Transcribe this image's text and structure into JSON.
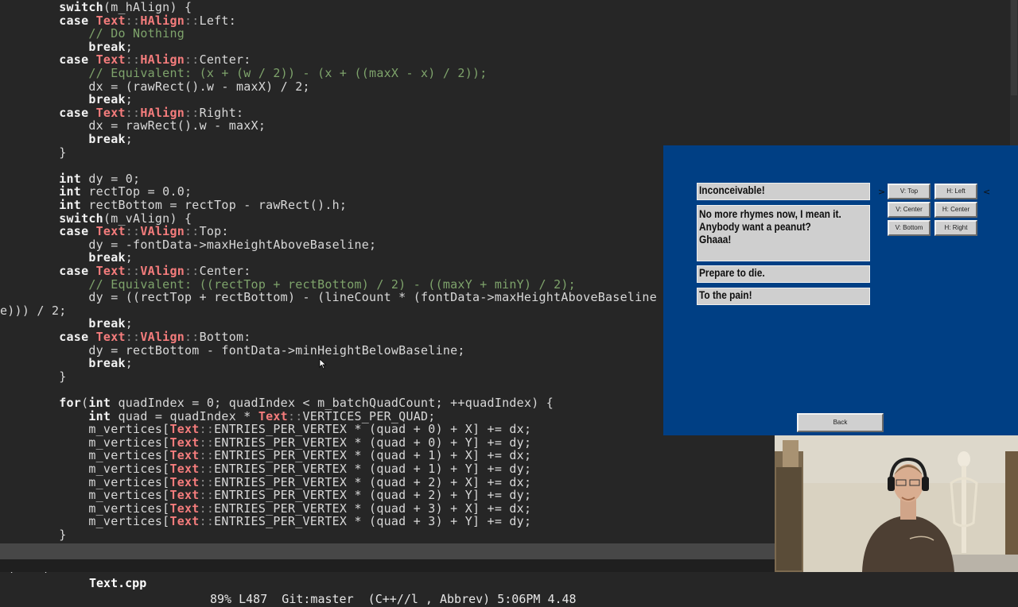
{
  "editor": {
    "lines": [
      [
        {
          "t": "        "
        },
        {
          "t": "switch",
          "c": "kw"
        },
        {
          "t": "(m_hAlign) {"
        }
      ],
      [
        {
          "t": "        "
        },
        {
          "t": "case",
          "c": "kw"
        },
        {
          "t": " "
        },
        {
          "t": "Text",
          "c": "type"
        },
        {
          "t": "::",
          "c": "punct"
        },
        {
          "t": "HAlign",
          "c": "type"
        },
        {
          "t": "::",
          "c": "punct"
        },
        {
          "t": "Left:"
        }
      ],
      [
        {
          "t": "            "
        },
        {
          "t": "// Do Nothing",
          "c": "comment"
        }
      ],
      [
        {
          "t": "            "
        },
        {
          "t": "break",
          "c": "kw"
        },
        {
          "t": ";"
        }
      ],
      [
        {
          "t": "        "
        },
        {
          "t": "case",
          "c": "kw"
        },
        {
          "t": " "
        },
        {
          "t": "Text",
          "c": "type"
        },
        {
          "t": "::",
          "c": "punct"
        },
        {
          "t": "HAlign",
          "c": "type"
        },
        {
          "t": "::",
          "c": "punct"
        },
        {
          "t": "Center:"
        }
      ],
      [
        {
          "t": "            "
        },
        {
          "t": "// Equivalent: (x + (w / 2)) - (x + ((maxX - x) / 2));",
          "c": "comment"
        }
      ],
      [
        {
          "t": "            dx = (rawRect().w - maxX) / 2;"
        }
      ],
      [
        {
          "t": "            "
        },
        {
          "t": "break",
          "c": "kw"
        },
        {
          "t": ";"
        }
      ],
      [
        {
          "t": "        "
        },
        {
          "t": "case",
          "c": "kw"
        },
        {
          "t": " "
        },
        {
          "t": "Text",
          "c": "type"
        },
        {
          "t": "::",
          "c": "punct"
        },
        {
          "t": "HAlign",
          "c": "type"
        },
        {
          "t": "::",
          "c": "punct"
        },
        {
          "t": "Right:"
        }
      ],
      [
        {
          "t": "            dx = rawRect().w - maxX;"
        }
      ],
      [
        {
          "t": "            "
        },
        {
          "t": "break",
          "c": "kw"
        },
        {
          "t": ";"
        }
      ],
      [
        {
          "t": "        }"
        }
      ],
      [
        {
          "t": ""
        }
      ],
      [
        {
          "t": "        "
        },
        {
          "t": "int",
          "c": "kw"
        },
        {
          "t": " dy = 0;"
        }
      ],
      [
        {
          "t": "        "
        },
        {
          "t": "int",
          "c": "kw"
        },
        {
          "t": " rectTop = 0.0;"
        }
      ],
      [
        {
          "t": "        "
        },
        {
          "t": "int",
          "c": "kw"
        },
        {
          "t": " rectBottom = rectTop - rawRect().h;"
        }
      ],
      [
        {
          "t": "        "
        },
        {
          "t": "switch",
          "c": "kw"
        },
        {
          "t": "(m_vAlign) {"
        }
      ],
      [
        {
          "t": "        "
        },
        {
          "t": "case",
          "c": "kw"
        },
        {
          "t": " "
        },
        {
          "t": "Text",
          "c": "type"
        },
        {
          "t": "::",
          "c": "punct"
        },
        {
          "t": "VAlign",
          "c": "type"
        },
        {
          "t": "::",
          "c": "punct"
        },
        {
          "t": "Top:"
        }
      ],
      [
        {
          "t": "            dy = -fontData->maxHeightAboveBaseline;"
        }
      ],
      [
        {
          "t": "            "
        },
        {
          "t": "break",
          "c": "kw"
        },
        {
          "t": ";"
        }
      ],
      [
        {
          "t": "        "
        },
        {
          "t": "case",
          "c": "kw"
        },
        {
          "t": " "
        },
        {
          "t": "Text",
          "c": "type"
        },
        {
          "t": "::",
          "c": "punct"
        },
        {
          "t": "VAlign",
          "c": "type"
        },
        {
          "t": "::",
          "c": "punct"
        },
        {
          "t": "Center:"
        }
      ],
      [
        {
          "t": "            "
        },
        {
          "t": "// Equivalent: ((rectTop + rectBottom) / 2) - ((maxY + minY) / 2);",
          "c": "comment"
        }
      ],
      [
        {
          "t": "            dy = ((rectTop + rectBottom) - (lineCount * (fontData->maxHeightAboveBaseline"
        }
      ],
      [
        {
          "t": "e))) / 2;"
        }
      ],
      [
        {
          "t": "            "
        },
        {
          "t": "break",
          "c": "kw"
        },
        {
          "t": ";"
        }
      ],
      [
        {
          "t": "        "
        },
        {
          "t": "case",
          "c": "kw"
        },
        {
          "t": " "
        },
        {
          "t": "Text",
          "c": "type"
        },
        {
          "t": "::",
          "c": "punct"
        },
        {
          "t": "VAlign",
          "c": "type"
        },
        {
          "t": "::",
          "c": "punct"
        },
        {
          "t": "Bottom:"
        }
      ],
      [
        {
          "t": "            dy = rectBottom - fontData->minHeightBelowBaseline;"
        }
      ],
      [
        {
          "t": "            "
        },
        {
          "t": "break",
          "c": "kw"
        },
        {
          "t": ";"
        }
      ],
      [
        {
          "t": "        }"
        }
      ],
      [
        {
          "t": ""
        }
      ],
      [
        {
          "t": "        "
        },
        {
          "t": "for",
          "c": "kw"
        },
        {
          "t": "("
        },
        {
          "t": "int",
          "c": "kw"
        },
        {
          "t": " quadIndex = 0; quadIndex < m_batchQuadCount; ++quadIndex) {"
        }
      ],
      [
        {
          "t": "            "
        },
        {
          "t": "int",
          "c": "kw"
        },
        {
          "t": " quad = quadIndex * "
        },
        {
          "t": "Text",
          "c": "type"
        },
        {
          "t": "::",
          "c": "punct"
        },
        {
          "t": "VERTICES_PER_QUAD;"
        }
      ],
      [
        {
          "t": "            m_vertices["
        },
        {
          "t": "Text",
          "c": "type"
        },
        {
          "t": "::",
          "c": "punct"
        },
        {
          "t": "ENTRIES_PER_VERTEX * (quad + 0) + X] += dx;"
        }
      ],
      [
        {
          "t": "            m_vertices["
        },
        {
          "t": "Text",
          "c": "type"
        },
        {
          "t": "::",
          "c": "punct"
        },
        {
          "t": "ENTRIES_PER_VERTEX * (quad + 0) + Y] += dy;"
        }
      ],
      [
        {
          "t": "            m_vertices["
        },
        {
          "t": "Text",
          "c": "type"
        },
        {
          "t": "::",
          "c": "punct"
        },
        {
          "t": "ENTRIES_PER_VERTEX * (quad + 1) + X] += dx;"
        }
      ],
      [
        {
          "t": "            m_vertices["
        },
        {
          "t": "Text",
          "c": "type"
        },
        {
          "t": "::",
          "c": "punct"
        },
        {
          "t": "ENTRIES_PER_VERTEX * (quad + 1) + Y] += dy;"
        }
      ],
      [
        {
          "t": "            m_vertices["
        },
        {
          "t": "Text",
          "c": "type"
        },
        {
          "t": "::",
          "c": "punct"
        },
        {
          "t": "ENTRIES_PER_VERTEX * (quad + 2) + X] += dx;"
        }
      ],
      [
        {
          "t": "            m_vertices["
        },
        {
          "t": "Text",
          "c": "type"
        },
        {
          "t": "::",
          "c": "punct"
        },
        {
          "t": "ENTRIES_PER_VERTEX * (quad + 2) + Y] += dy;"
        }
      ],
      [
        {
          "t": "            m_vertices["
        },
        {
          "t": "Text",
          "c": "type"
        },
        {
          "t": "::",
          "c": "punct"
        },
        {
          "t": "ENTRIES_PER_VERTEX * (quad + 3) + X] += dx;"
        }
      ],
      [
        {
          "t": "            m_vertices["
        },
        {
          "t": "Text",
          "c": "type"
        },
        {
          "t": "::",
          "c": "punct"
        },
        {
          "t": "ENTRIES_PER_VERTEX * (quad + 3) + Y] += dy;"
        }
      ],
      [
        {
          "t": "        }"
        }
      ]
    ]
  },
  "modeline": {
    "left": "-(Unix)---",
    "file": "Text.cpp",
    "rest": "89% L487  Git:master  (C++//l , Abbrev) 5:06PM 4.48"
  },
  "game": {
    "textboxes": [
      {
        "lines": [
          "Inconceivable!"
        ]
      },
      {
        "lines": [
          "No more rhymes now, I mean it.",
          "Anybody want a peanut?",
          "Ghaaa!"
        ]
      },
      {
        "lines": [
          "Prepare to die."
        ]
      },
      {
        "lines": [
          "To the pain!"
        ]
      }
    ],
    "buttons": {
      "v_top": "V: Top",
      "v_center": "V: Center",
      "v_bottom": "V: Bottom",
      "h_left": "H: Left",
      "h_center": "H: Center",
      "h_right": "H: Right",
      "back": "Back"
    },
    "selection_marker_left": ">",
    "selection_marker_right": "<"
  },
  "colors": {
    "editor_bg": "#262626",
    "keyword": "#f2f2f2",
    "type": "#f47c7c",
    "comment": "#7ea36b",
    "game_bg": "#003f84"
  }
}
